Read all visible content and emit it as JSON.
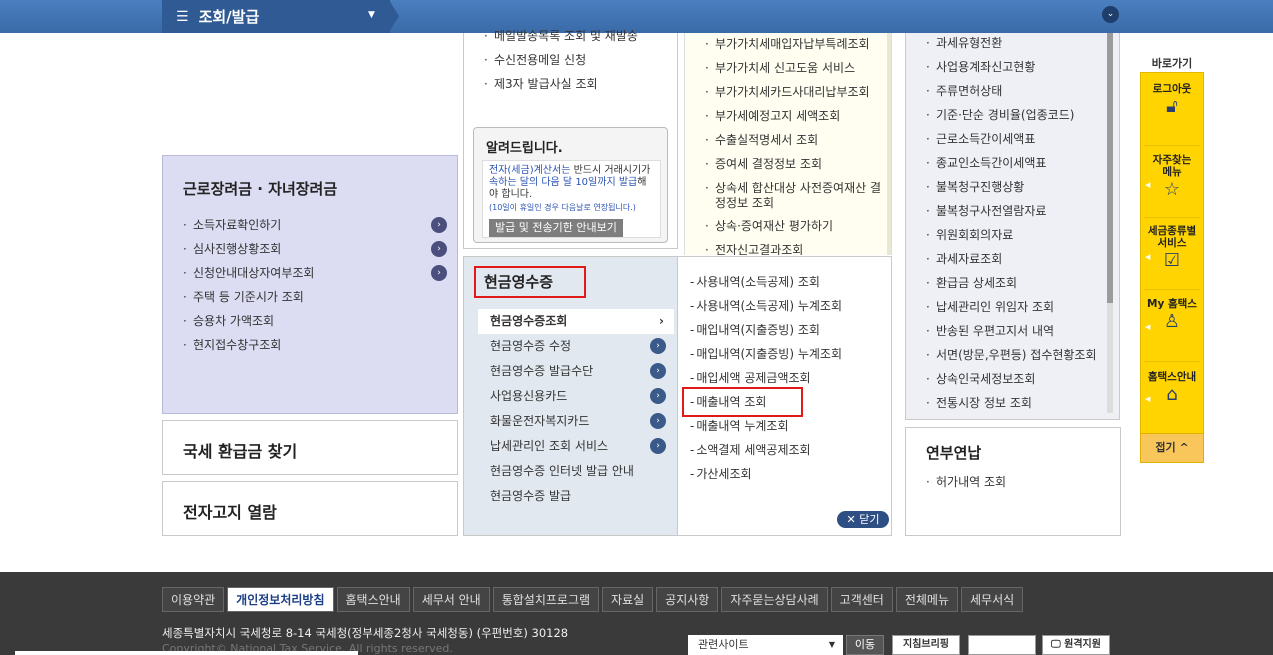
{
  "topbar": {
    "menu_icon": "hamburger-icon",
    "title": "조회/발급",
    "dropdown_icon": "caret-down-icon",
    "collapse_icon": "chevron-down-icon"
  },
  "kunro": {
    "title": "근로장려금 · 자녀장려금",
    "items": [
      "소득자료확인하기",
      "심사진행상황조회",
      "신청안내대상자여부조회",
      "주택 등 기준시가 조회",
      "승용차 가액조회",
      "현지접수창구조회"
    ]
  },
  "refund": {
    "title": "국세 환급금 찾기"
  },
  "jeonja": {
    "title": "전자고지 열람"
  },
  "midtop": {
    "items": [
      "메일발송목록 조회 및 재발송",
      "수신전용메일 신청",
      "제3자 발급사실 조회"
    ]
  },
  "notice": {
    "title": "알려드립니다.",
    "text_highlight": "전자(세금)계산서는",
    "text_1": " 반드시 거래시기가 ",
    "text_highlight2": "속하는 달의 다음 달 10일까지 발급",
    "text_2": "해야 합니다.",
    "small": "(10일이 휴일인 경우 다음날로 연장됩니다.)",
    "button": "발급 및 전송기한 안내보기"
  },
  "col2top": {
    "items": [
      "부가가치세매입자납부특례조회",
      "부가가치세 신고도움 서비스",
      "부가가치세카드사대리납부조회",
      "부가세예정고지 세액조회",
      "수출실적명세서 조회",
      "증여세 결정정보 조회",
      "상속세 합산대상 사전증여재산 결정정보 조회",
      "상속·증여재산 평가하기",
      "전자신고결과조회"
    ]
  },
  "col3": {
    "items": [
      "과세유형전환",
      "사업용계좌신고현황",
      "주류면허상태",
      "기준·단순 경비율(업종코드)",
      "근로소득간이세액표",
      "종교인소득간이세액표",
      "불복청구진행상황",
      "불복청구사전열람자료",
      "위원회회의자료",
      "과세자료조회",
      "환급금 상세조회",
      "납세관리인 위임자 조회",
      "반송된 우편고지서 내역",
      "서면(방문,우편등) 접수현황조회",
      "상속인국세정보조회",
      "전통시장 정보 조회"
    ]
  },
  "cash": {
    "title": "현금영수증",
    "items": [
      "현금영수증조회",
      "현금영수증 수정",
      "현금영수증 발급수단",
      "사업용신용카드",
      "화물운전자복지카드",
      "납세관리인 조회 서비스",
      "현금영수증 인터넷 발급 안내",
      "현금영수증 발급"
    ],
    "sub_items": [
      "사용내역(소득공제) 조회",
      "사용내역(소득공제) 누계조회",
      "매입내역(지출증빙) 조회",
      "매입내역(지출증빙) 누계조회",
      "매입세액 공제금액조회",
      "매출내역 조회",
      "매출내역 누계조회",
      "소액결제 세액공제조회",
      "가산세조회"
    ],
    "close": "닫기"
  },
  "yeonbu": {
    "title": "연부연납",
    "items": [
      "허가내역 조회"
    ]
  },
  "sidebar": {
    "title": "바로가기",
    "items": [
      {
        "label": "로그아웃",
        "icon": "lock-icon"
      },
      {
        "label": "자주찾는 메뉴",
        "icon": "star-icon"
      },
      {
        "label": "세금종류별 서비스",
        "icon": "checkbox-icon"
      },
      {
        "label": "My 홈택스",
        "icon": "user-icon"
      },
      {
        "label": "홈택스안내",
        "icon": "home-info-icon"
      }
    ],
    "fold": "접기"
  },
  "footer": {
    "links": [
      "이용약관",
      "개인정보처리방침",
      "홈택스안내",
      "세무서 안내",
      "통합설치프로그램",
      "자료실",
      "공지사항",
      "자주묻는상담사례",
      "고객센터",
      "전체메뉴",
      "세무서식"
    ],
    "address": "세종특별자치시 국세청로 8-14 국세청(정부세종2청사 국세청동) (우편번호) 30128",
    "copyright": "Copyright© National Tax Service. All rights reserved.",
    "related": "관련사이트",
    "move": "이동",
    "banners": [
      "지침브리핑",
      "",
      "원격지원"
    ]
  },
  "colors": {
    "topbar": "#3a6aa8",
    "highlight_red": "#e01919",
    "sidebar_yellow": "#ffd400",
    "kunro_bg": "#dcdcf3"
  }
}
